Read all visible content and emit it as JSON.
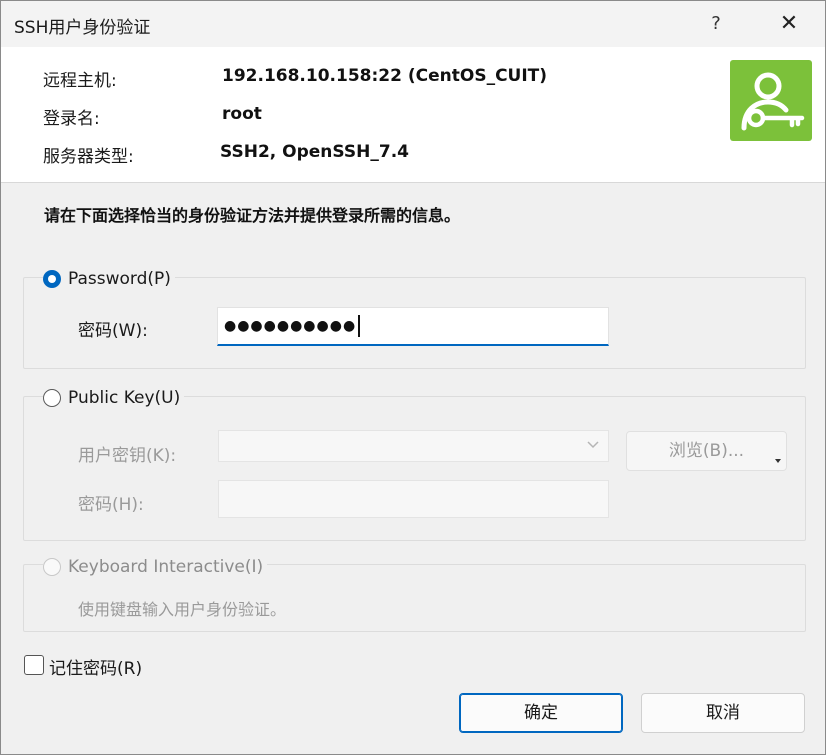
{
  "window": {
    "title": "SSH用户身份验证",
    "help_label": "?",
    "close_label": "✕"
  },
  "info": {
    "host_label": "远程主机:",
    "host_value": "192.168.10.158:22 (CentOS_CUIT)",
    "login_label": "登录名:",
    "login_value": "root",
    "server_label": "服务器类型:",
    "server_value": "SSH2, OpenSSH_7.4",
    "logo_icon": "user-key-icon",
    "logo_color": "#7cc13a"
  },
  "instruction": "请在下面选择恰当的身份验证方法并提供登录所需的信息。",
  "password_group": {
    "option_label": "Password(P)",
    "selected": true,
    "field_label": "密码(W):",
    "masked_value": "●●●●●●●●●●"
  },
  "publickey_group": {
    "option_label": "Public Key(U)",
    "selected": false,
    "key_label": "用户密钥(K):",
    "key_value": "",
    "browse_label": "浏览(B)...",
    "passphrase_label": "密码(H):",
    "passphrase_value": ""
  },
  "keyboard_group": {
    "option_label": "Keyboard Interactive(I)",
    "selected": false,
    "description": "使用键盘输入用户身份验证。"
  },
  "remember": {
    "label": "记住密码(R)",
    "checked": false
  },
  "buttons": {
    "ok_label": "确定",
    "cancel_label": "取消"
  },
  "colors": {
    "accent": "#0067c0"
  }
}
